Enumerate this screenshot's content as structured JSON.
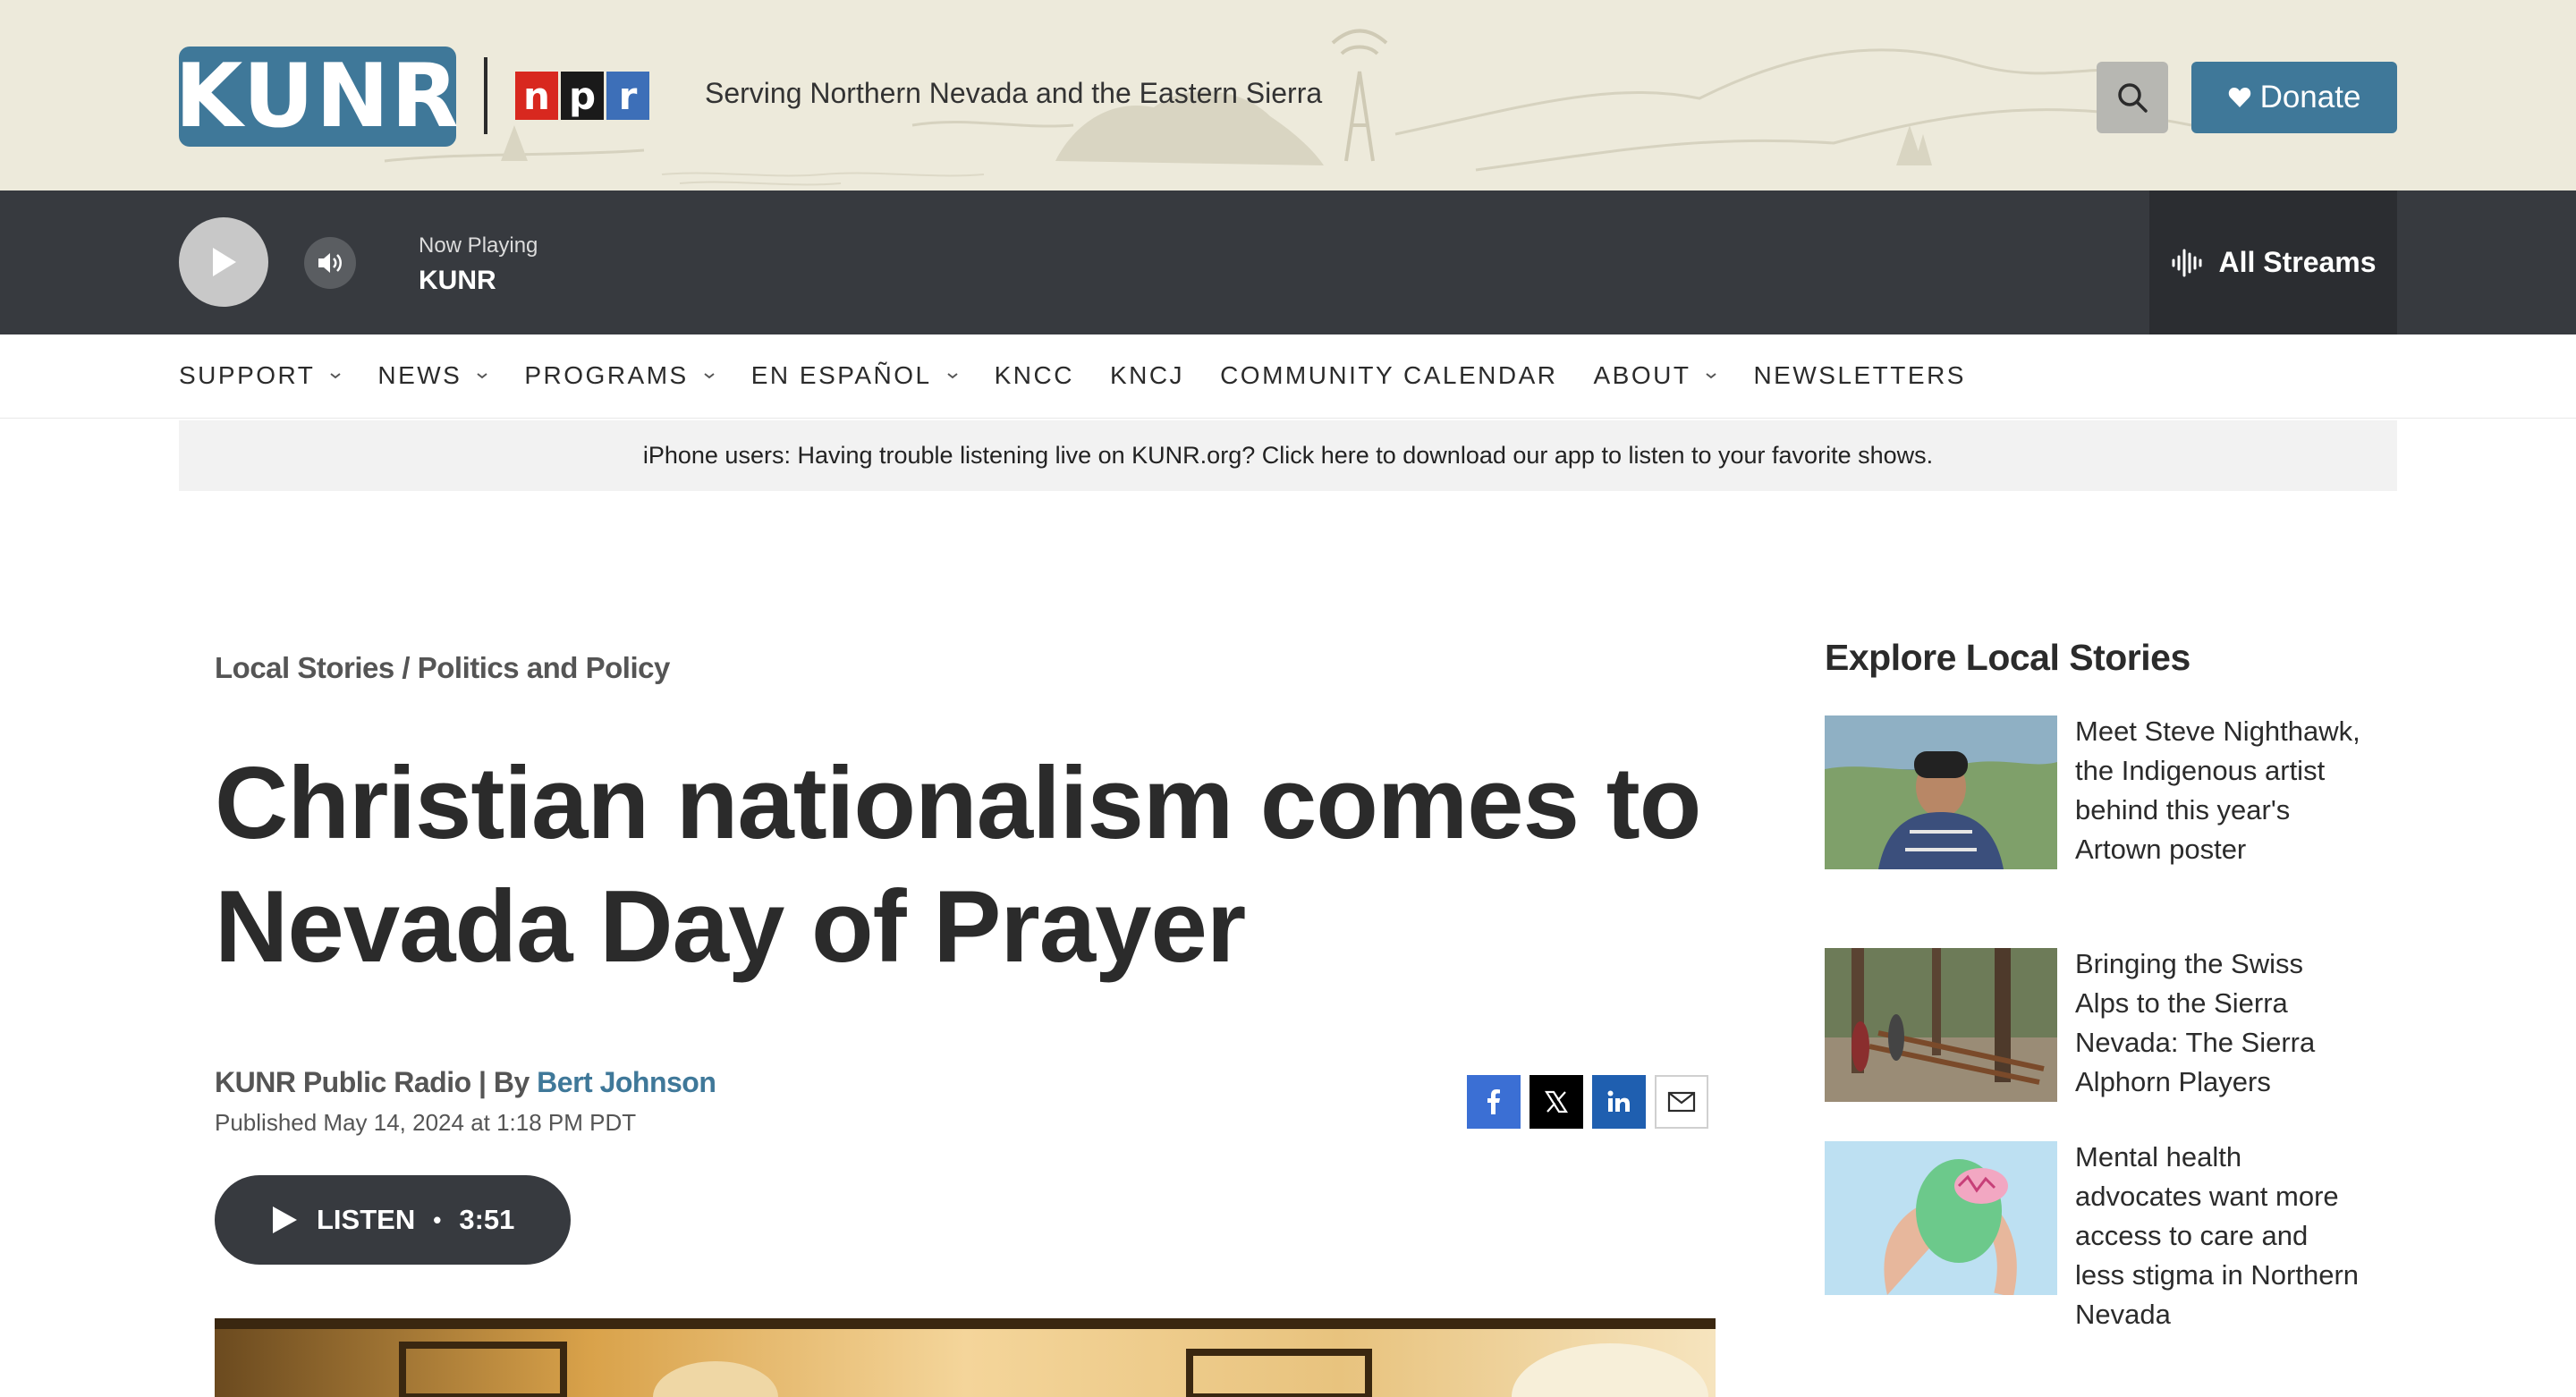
{
  "header": {
    "logo_text": "KUNR",
    "npr_letters": [
      "n",
      "p",
      "r"
    ],
    "tagline": "Serving Northern Nevada and the Eastern Sierra",
    "search_icon": "search-icon",
    "donate_label": "Donate",
    "donate_icon": "heart-icon"
  },
  "player": {
    "now_playing_label": "Now Playing",
    "station": "KUNR",
    "all_streams_label": "All Streams",
    "icons": [
      "play-icon",
      "volume-icon",
      "audio-wave-icon"
    ]
  },
  "nav": {
    "items": [
      {
        "label": "SUPPORT",
        "dropdown": true
      },
      {
        "label": "NEWS",
        "dropdown": true
      },
      {
        "label": "PROGRAMS",
        "dropdown": true
      },
      {
        "label": "EN ESPAÑOL",
        "dropdown": true
      },
      {
        "label": "KNCC",
        "dropdown": false
      },
      {
        "label": "KNCJ",
        "dropdown": false
      },
      {
        "label": "COMMUNITY CALENDAR",
        "dropdown": false
      },
      {
        "label": "ABOUT",
        "dropdown": true
      },
      {
        "label": "NEWSLETTERS",
        "dropdown": false
      }
    ]
  },
  "alert": {
    "text": "iPhone users: Having trouble listening live on KUNR.org? Click here to download our app to listen to your favorite shows."
  },
  "article": {
    "breadcrumb": "Local Stories / Politics and Policy",
    "headline": "Christian nationalism comes to Nevada Day of Prayer",
    "byline_prefix": "KUNR Public Radio | By ",
    "author": "Bert Johnson",
    "published": "Published May 14, 2024 at 1:18 PM PDT",
    "listen_label": "LISTEN",
    "listen_separator": "•",
    "listen_duration": "3:51",
    "share_icons": [
      "facebook-icon",
      "x-icon",
      "linkedin-icon",
      "email-icon"
    ]
  },
  "sidebar": {
    "title": "Explore Local Stories",
    "stories": [
      {
        "title": "Meet Steve Nighthawk, the Indigenous artist behind this year's Artown poster"
      },
      {
        "title": "Bringing the Swiss Alps to the Sierra Nevada: The Sierra Alphorn Players"
      },
      {
        "title": "Mental health advocates want more access to care and less stigma in Northern Nevada"
      }
    ]
  },
  "colors": {
    "brand_blue": "#3f7899",
    "header_bg": "#edeadb",
    "player_bg": "#373a3f",
    "npr_red": "#d8281f",
    "npr_black": "#1a1a1a",
    "npr_blue": "#3d6fb8"
  }
}
